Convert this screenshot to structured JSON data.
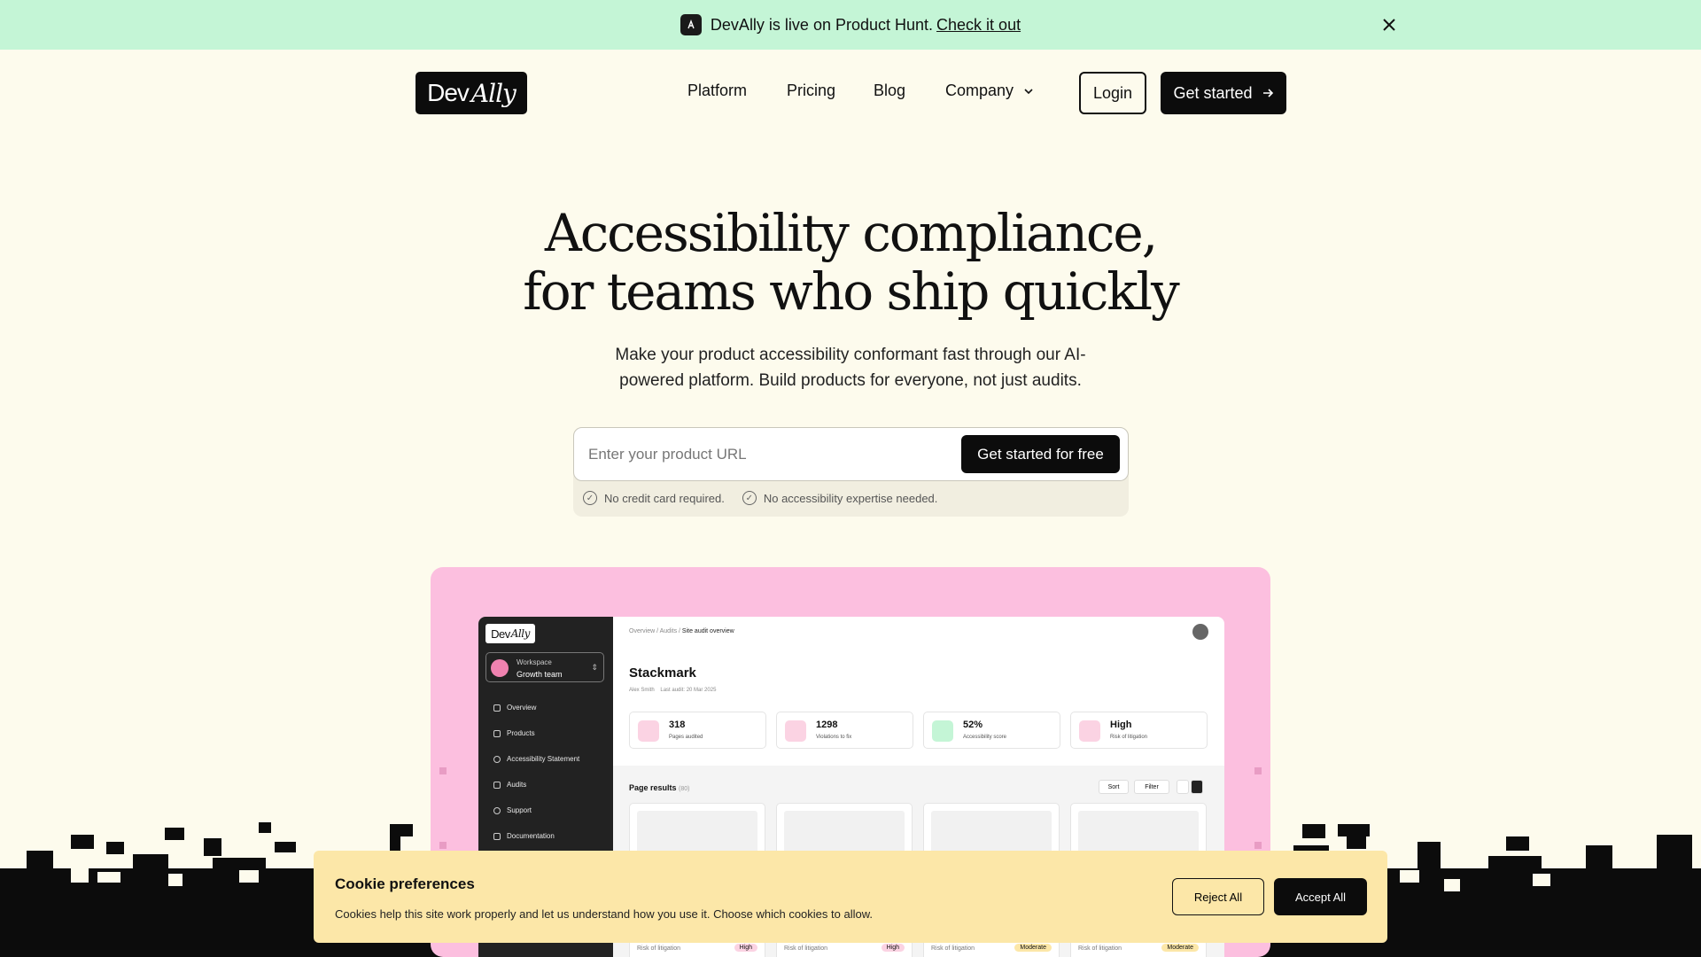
{
  "announcement": {
    "text": "DevAlly is live on Product Hunt.",
    "link": "Check it out"
  },
  "brand": {
    "part1": "Dev",
    "part2": "Ally"
  },
  "nav": {
    "platform": "Platform",
    "pricing": "Pricing",
    "blog": "Blog",
    "company": "Company",
    "login": "Login",
    "get_started": "Get started"
  },
  "hero": {
    "title_line1": "Accessibility compliance,",
    "title_line2": "for teams who ship quickly",
    "subtitle": "Make your product accessibility conformant fast through our AI-powered platform. Build products for everyone, not just audits.",
    "url_placeholder": "Enter your product URL",
    "cta": "Get started for free",
    "check1": "No credit card required.",
    "check2": "No accessibility expertise needed."
  },
  "app": {
    "workspace_label": "Workspace",
    "workspace_name": "Growth team",
    "sidebar": [
      "Overview",
      "Products",
      "Accessibility Statement",
      "Audits",
      "Support",
      "Documentation"
    ],
    "breadcrumb_a": "Overview / Audits /",
    "breadcrumb_b": "Site audit overview",
    "project": "Stackmark",
    "owner": "Alex Smith",
    "last_audit": "Last audit: 20 Mar 2025",
    "stats": [
      {
        "value": "318",
        "label": "Pages audited"
      },
      {
        "value": "1298",
        "label": "Violations to fix"
      },
      {
        "value": "52%",
        "label": "Accessibility score"
      },
      {
        "value": "High",
        "label": "Risk of litigation"
      }
    ],
    "results_title": "Page results",
    "results_count": "(80)",
    "sort": "Sort",
    "filter": "Filter",
    "risk_label": "Risk of litigation",
    "badges": [
      "High",
      "High",
      "Moderate",
      "Moderate"
    ]
  },
  "cookie": {
    "title": "Cookie preferences",
    "text": "Cookies help this site work properly and let us understand how you use it. Choose which cookies to allow.",
    "reject": "Reject All",
    "accept": "Accept All"
  }
}
